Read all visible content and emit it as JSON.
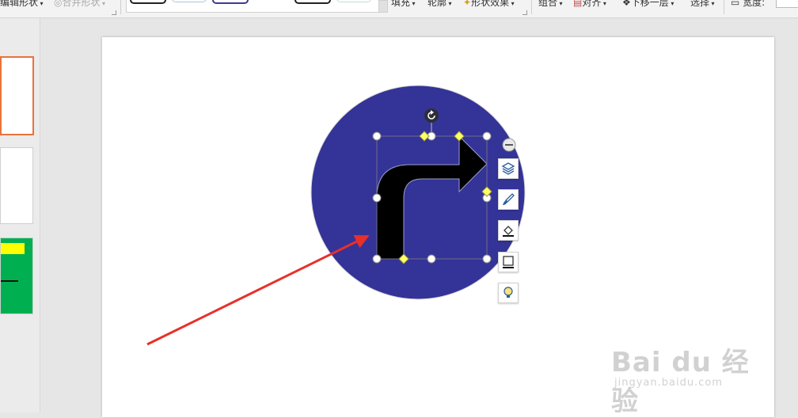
{
  "ribbon": {
    "edit_shape": "编辑形状",
    "merge_shape": "合并形状",
    "fill": "填充",
    "outline": "轮廓",
    "shape_effects": "形状效果",
    "group": "组合",
    "align": "对齐",
    "send_backward": "下移一层",
    "select": "选择",
    "width_label": "宽度:"
  },
  "watermark": {
    "brand": "Bai du 经验",
    "url": "jingyan.baidu.com"
  },
  "colors": {
    "circle_fill": "#343397",
    "arrow_fill": "#000000",
    "annotation_arrow": "#e8302a",
    "thumb_selected_border": "#e8733a",
    "thumb3_bg": "#00b050",
    "thumb3_bar": "#ffff00"
  },
  "icons": {
    "float_toolbar": [
      "layers-icon",
      "brush-icon",
      "fill-icon",
      "outline-icon",
      "lightbulb-icon"
    ],
    "rotate": "rotate-icon",
    "collapse": "minus-icon"
  }
}
